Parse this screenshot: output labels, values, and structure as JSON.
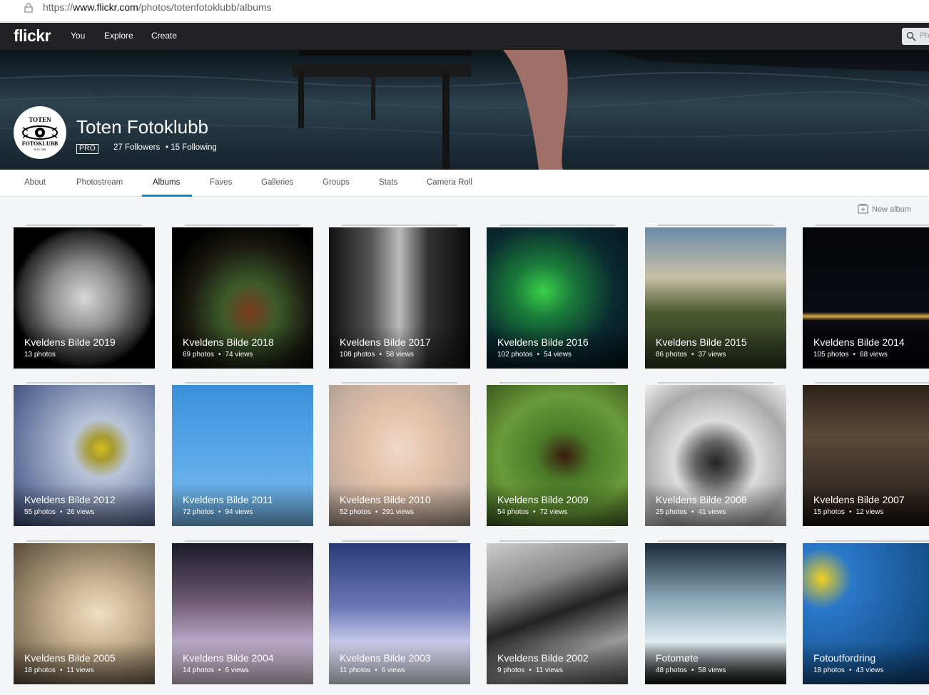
{
  "browser": {
    "url_prefix": "https://",
    "url_domain": "www.flickr.com",
    "url_path": "/photos/totenfotoklubb/albums"
  },
  "nav": {
    "logo": "flickr",
    "links": [
      "You",
      "Explore",
      "Create"
    ],
    "search_placeholder": "Ph"
  },
  "profile": {
    "name": "Toten Fotoklubb",
    "badge": "PRO",
    "followers": "27 Followers",
    "following": "• 15 Following"
  },
  "tabs": [
    "About",
    "Photostream",
    "Albums",
    "Faves",
    "Galleries",
    "Groups",
    "Stats",
    "Camera Roll"
  ],
  "active_tab": "Albums",
  "new_album_label": "New album",
  "albums": [
    {
      "name": "Kveldens Bilde 2019",
      "photos": "13 photos",
      "views": ""
    },
    {
      "name": "Kveldens Bilde 2018",
      "photos": "69 photos",
      "views": "74 views"
    },
    {
      "name": "Kveldens Bilde 2017",
      "photos": "108 photos",
      "views": "58 views"
    },
    {
      "name": "Kveldens Bilde 2016",
      "photos": "102 photos",
      "views": "54 views"
    },
    {
      "name": "Kveldens Bilde 2015",
      "photos": "86 photos",
      "views": "37 views"
    },
    {
      "name": "Kveldens Bilde 2014",
      "photos": "105 photos",
      "views": "68 views"
    },
    {
      "name": "Kveldens Bilde 2012",
      "photos": "55 photos",
      "views": "26 views"
    },
    {
      "name": "Kveldens Bilde 2011",
      "photos": "72 photos",
      "views": "94 views"
    },
    {
      "name": "Kveldens Bilde 2010",
      "photos": "52 photos",
      "views": "291 views"
    },
    {
      "name": "Kveldens Bilde 2009",
      "photos": "54 photos",
      "views": "72 views"
    },
    {
      "name": "Kveldens Bilde 2008",
      "photos": "25 photos",
      "views": "41 views"
    },
    {
      "name": "Kveldens Bilde 2007",
      "photos": "15 photos",
      "views": "12 views"
    },
    {
      "name": "Kveldens Bilde 2005",
      "photos": "18 photos",
      "views": "11 views"
    },
    {
      "name": "Kveldens Bilde 2004",
      "photos": "14 photos",
      "views": "6 views"
    },
    {
      "name": "Kveldens Bilde 2003",
      "photos": "11 photos",
      "views": "6 views"
    },
    {
      "name": "Kveldens Bilde 2002",
      "photos": "9 photos",
      "views": "11 views"
    },
    {
      "name": "Fotomøte",
      "photos": "48 photos",
      "views": "58 views"
    },
    {
      "name": "Fotoutfordring",
      "photos": "18 photos",
      "views": "43 views"
    }
  ],
  "colors": {
    "topnav": "#212124",
    "accent": "#008ecf",
    "page_bg": "#f3f5f6"
  }
}
